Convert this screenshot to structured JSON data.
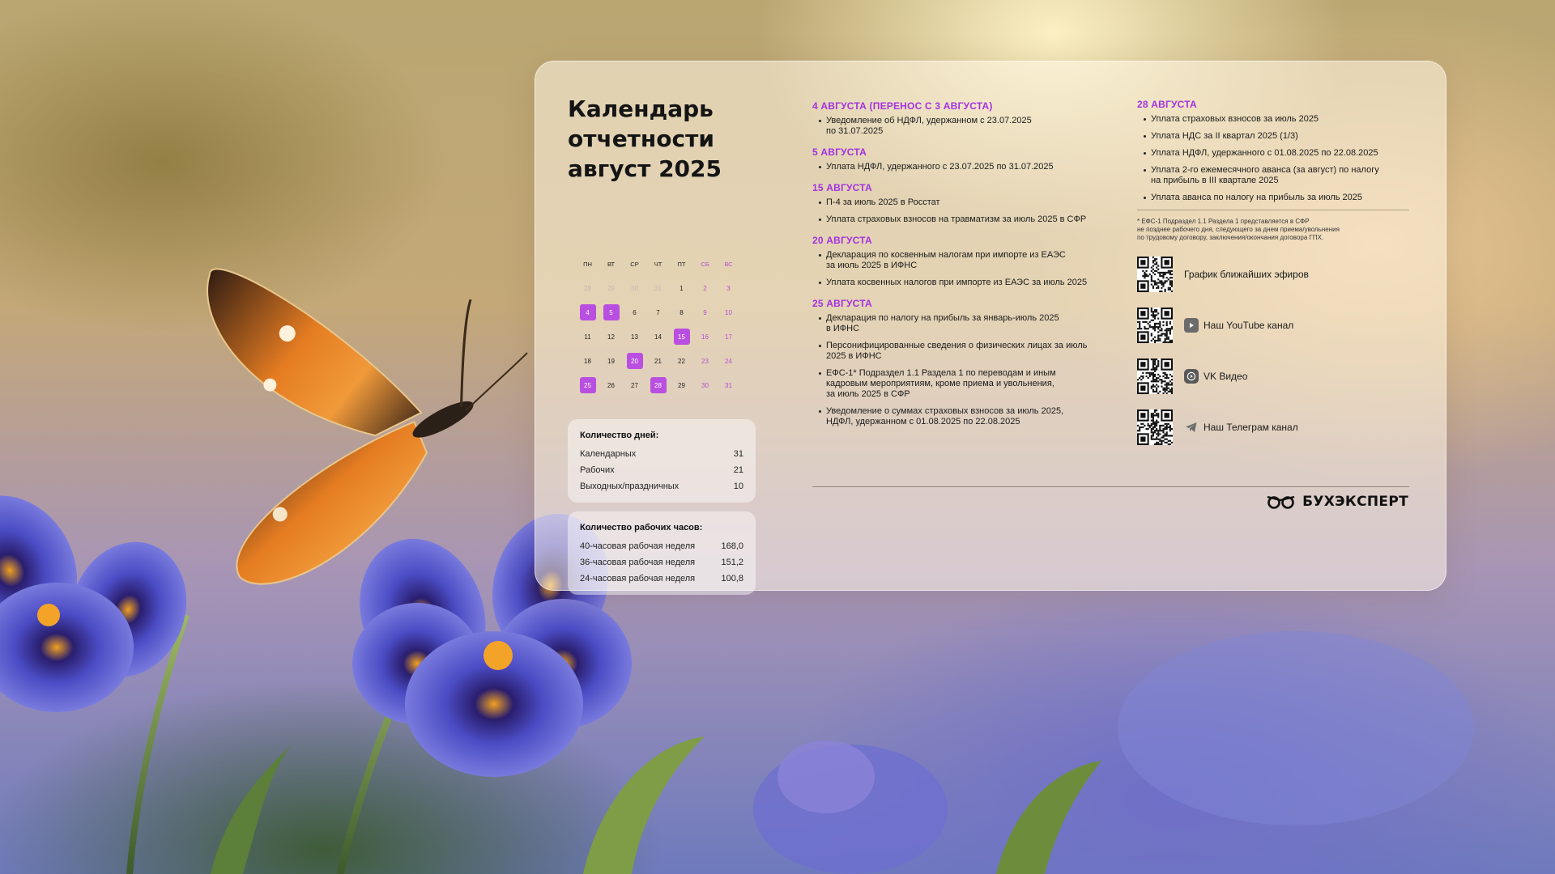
{
  "title": "Календарь\nотчетности\nавгуст 2025",
  "calendar": {
    "weekdays": [
      "ПН",
      "ВТ",
      "СР",
      "ЧТ",
      "ПТ",
      "СБ",
      "ВС"
    ],
    "weeks": [
      [
        "28",
        "29",
        "30",
        "31",
        "1",
        "2",
        "3"
      ],
      [
        "4",
        "5",
        "6",
        "7",
        "8",
        "9",
        "10"
      ],
      [
        "11",
        "12",
        "13",
        "14",
        "15",
        "16",
        "17"
      ],
      [
        "18",
        "19",
        "20",
        "21",
        "22",
        "23",
        "24"
      ],
      [
        "25",
        "26",
        "27",
        "28",
        "29",
        "30",
        "31"
      ]
    ],
    "highlighted_days": [
      "4",
      "5",
      "15",
      "20",
      "25",
      "28"
    ],
    "accent_color": "#b94fe0"
  },
  "days_count": {
    "title": "Количество дней:",
    "rows": [
      {
        "label": "Календарных",
        "value": "31"
      },
      {
        "label": "Рабочих",
        "value": "21"
      },
      {
        "label": "Выходных/праздничных",
        "value": "10"
      }
    ]
  },
  "hours_count": {
    "title": "Количество рабочих часов:",
    "rows": [
      {
        "label": "40-часовая рабочая неделя",
        "value": "168,0"
      },
      {
        "label": "36-часовая рабочая неделя",
        "value": "151,2"
      },
      {
        "label": "24-часовая рабочая неделя",
        "value": "100,8"
      }
    ]
  },
  "deadlines": [
    {
      "date": "4 АВГУСТА (ПЕРЕНОС С 3 АВГУСТА)",
      "items": [
        "Уведомление об НДФЛ, удержанном с 23.07.2025\nпо 31.07.2025"
      ]
    },
    {
      "date": "5 АВГУСТА",
      "items": [
        "Уплата НДФЛ, удержанного с 23.07.2025 по 31.07.2025"
      ]
    },
    {
      "date": "15 АВГУСТА",
      "items": [
        "П-4 за июль 2025 в Росстат",
        "Уплата страховых взносов на травматизм за июль 2025 в СФР"
      ]
    },
    {
      "date": "20 АВГУСТА",
      "items": [
        "Декларация по косвенным налогам при импорте из ЕАЭС\nза июль 2025  в ИФНС",
        "Уплата косвенных налогов при импорте из ЕАЭС за июль 2025"
      ]
    },
    {
      "date": "25 АВГУСТА",
      "items": [
        "Декларация по налогу на прибыль за январь-июль 2025\nв ИФНС",
        "Персонифицированные сведения о физических лицах за июль\n2025 в ИФНС",
        "ЕФС-1* Подраздел 1.1 Раздела 1 по переводам и иным\nкадровым мероприятиям, кроме приема и увольнения,\nза июль 2025 в СФР",
        "Уведомление о суммах страховых взносов за июль 2025,\nНДФЛ, удержанном с 01.08.2025 по 22.08.2025"
      ]
    }
  ],
  "right_deadline": {
    "date": "28 АВГУСТА",
    "items": [
      "Уплата страховых взносов за июль 2025",
      "Уплата НДС за II квартал 2025 (1/3)",
      "Уплата НДФЛ, удержанного с 01.08.2025 по 22.08.2025",
      "Уплата 2-го ежемесячного аванса (за август) по налогу\nна прибыль в III квартале 2025",
      "Уплата аванса по налогу на прибыль за июль 2025"
    ]
  },
  "footnote": "* ЕФС-1 Подраздел 1.1 Раздела 1 представляется в СФР\nне позднее рабочего дня, следующего за днем приема/увольнения\nпо трудовому договору, заключения/окончания договора ГПХ.",
  "links": [
    {
      "label": "График ближайших эфиров",
      "icon": "none"
    },
    {
      "label": "Наш YouTube канал",
      "icon": "youtube-icon"
    },
    {
      "label": "VK Видео",
      "icon": "vk-video-icon"
    },
    {
      "label": "Наш Телеграм канал",
      "icon": "telegram-icon"
    }
  ],
  "brand": {
    "name": "БУХЭКСПЕРТ",
    "accent": "#a431e0"
  }
}
